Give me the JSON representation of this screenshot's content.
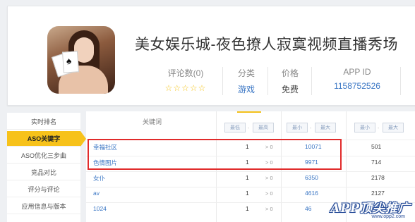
{
  "app": {
    "title": "美女娱乐城-夜色撩人寂寞视频直播秀场",
    "rating_label": "评论数(0)",
    "rating_stars": "☆☆☆☆☆",
    "category_label": "分类",
    "category_value": "游戏",
    "price_label": "价格",
    "price_value": "免费",
    "appid_label": "APP ID",
    "appid_value": "1158752526"
  },
  "sidebar": {
    "items": [
      {
        "label": "实时排名"
      },
      {
        "label": "ASO关键字"
      },
      {
        "label": "ASO优化三步曲"
      },
      {
        "label": "竞品对比"
      },
      {
        "label": "评分与评论"
      },
      {
        "label": "应用信息与版本"
      }
    ],
    "active_index": 1
  },
  "table": {
    "keyword_header": "关键词",
    "filters": {
      "col1_min": "最低",
      "col1_max": "最高",
      "col2_min": "最小",
      "col2_max": "最大",
      "col3_min": "最小",
      "col3_max": "最大",
      "dash": "-"
    },
    "rows": [
      {
        "keyword": "幸福社区",
        "rank": "1",
        "change": "> 0",
        "index": "10071",
        "results": "501"
      },
      {
        "keyword": "色情图片",
        "rank": "1",
        "change": "> 0",
        "index": "9971",
        "results": "714"
      },
      {
        "keyword": "女仆",
        "rank": "1",
        "change": "> 0",
        "index": "6350",
        "results": "2178"
      },
      {
        "keyword": "av",
        "rank": "1",
        "change": "> 0",
        "index": "4616",
        "results": "2127"
      },
      {
        "keyword": "1024",
        "rank": "1",
        "change": "> 0",
        "index": "46",
        "results": ""
      }
    ]
  },
  "watermark": {
    "main": "APP顶尖推广",
    "url": "www.opp2.com"
  },
  "colors": {
    "accent": "#f7c21a",
    "link": "#3a76c4",
    "highlight": "#e12b2b"
  }
}
